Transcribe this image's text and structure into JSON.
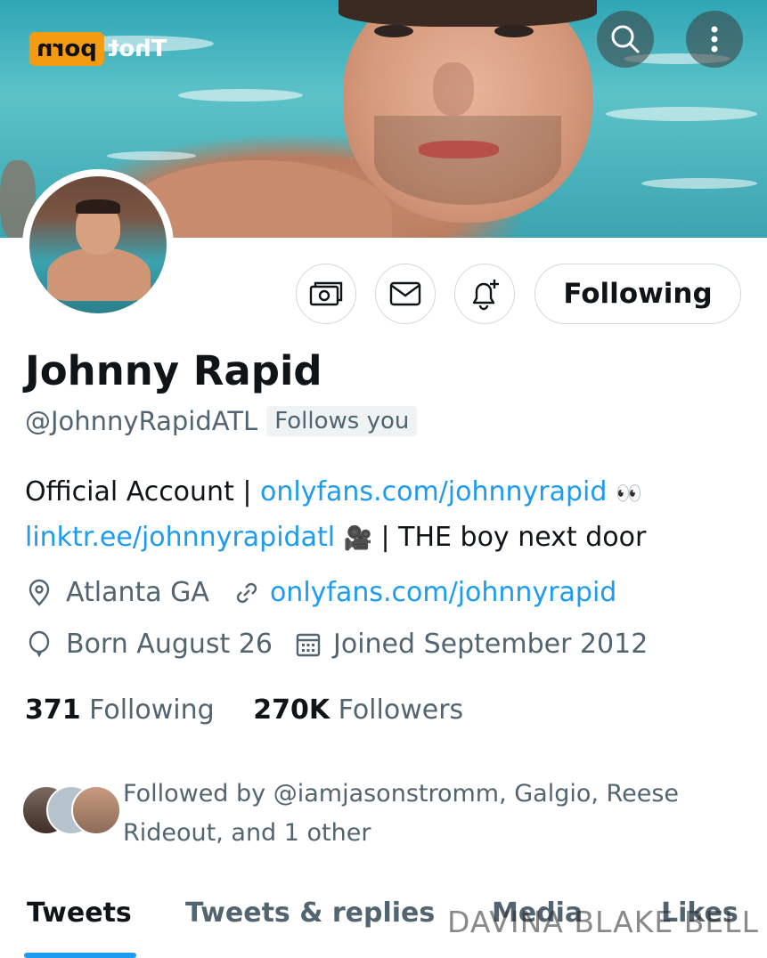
{
  "logo": {
    "badge": "porn",
    "text": "Thot"
  },
  "profile": {
    "name": "Johnny Rapid",
    "handle": "@JohnnyRapidATL",
    "follows_you": "Follows you",
    "follow_button": "Following",
    "bio": {
      "prefix": "Official Account | ",
      "link1": "onlyfans.com/johnnyrapid",
      "emoji1": "👀",
      "link2": "linktr.ee/johnnyrapidatl",
      "emoji2": "🎥",
      "suffix": " | THE boy next door"
    },
    "location": "Atlanta GA",
    "website": "onlyfans.com/johnnyrapid",
    "birthday": "Born August 26",
    "joined": "Joined September 2012",
    "following_count": "371",
    "following_label": "Following",
    "followers_count": "270K",
    "followers_label": "Followers",
    "followed_by": "Followed by @iamjasonstromm, Galgio, Reese Rideout, and 1 other"
  },
  "tabs": [
    "Tweets",
    "Tweets & replies",
    "Media",
    "Likes"
  ],
  "watermark": "DAVINA BLAKE BELL",
  "colors": {
    "accent": "#1d9bf0",
    "muted": "#536471",
    "text": "#0f1419",
    "logo_badge": "#f59b11"
  },
  "icons": [
    "search-icon",
    "more-vertical-icon",
    "tip-money-icon",
    "mail-icon",
    "bell-plus-icon",
    "location-icon",
    "link-icon",
    "balloon-icon",
    "calendar-icon"
  ]
}
